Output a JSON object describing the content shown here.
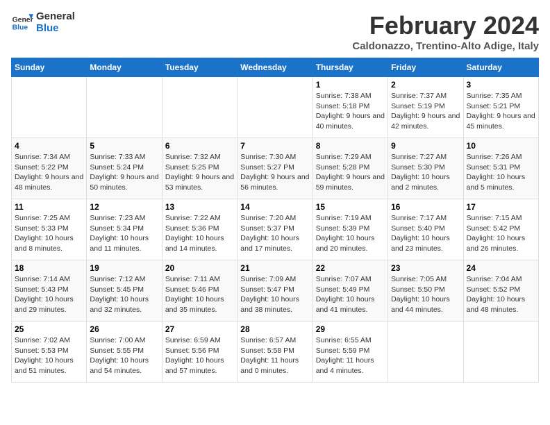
{
  "logo": {
    "line1": "General",
    "line2": "Blue"
  },
  "title": "February 2024",
  "subtitle": "Caldonazzo, Trentino-Alto Adige, Italy",
  "weekdays": [
    "Sunday",
    "Monday",
    "Tuesday",
    "Wednesday",
    "Thursday",
    "Friday",
    "Saturday"
  ],
  "weeks": [
    [
      {
        "day": "",
        "info": ""
      },
      {
        "day": "",
        "info": ""
      },
      {
        "day": "",
        "info": ""
      },
      {
        "day": "",
        "info": ""
      },
      {
        "day": "1",
        "info": "Sunrise: 7:38 AM\nSunset: 5:18 PM\nDaylight: 9 hours and 40 minutes."
      },
      {
        "day": "2",
        "info": "Sunrise: 7:37 AM\nSunset: 5:19 PM\nDaylight: 9 hours and 42 minutes."
      },
      {
        "day": "3",
        "info": "Sunrise: 7:35 AM\nSunset: 5:21 PM\nDaylight: 9 hours and 45 minutes."
      }
    ],
    [
      {
        "day": "4",
        "info": "Sunrise: 7:34 AM\nSunset: 5:22 PM\nDaylight: 9 hours and 48 minutes."
      },
      {
        "day": "5",
        "info": "Sunrise: 7:33 AM\nSunset: 5:24 PM\nDaylight: 9 hours and 50 minutes."
      },
      {
        "day": "6",
        "info": "Sunrise: 7:32 AM\nSunset: 5:25 PM\nDaylight: 9 hours and 53 minutes."
      },
      {
        "day": "7",
        "info": "Sunrise: 7:30 AM\nSunset: 5:27 PM\nDaylight: 9 hours and 56 minutes."
      },
      {
        "day": "8",
        "info": "Sunrise: 7:29 AM\nSunset: 5:28 PM\nDaylight: 9 hours and 59 minutes."
      },
      {
        "day": "9",
        "info": "Sunrise: 7:27 AM\nSunset: 5:30 PM\nDaylight: 10 hours and 2 minutes."
      },
      {
        "day": "10",
        "info": "Sunrise: 7:26 AM\nSunset: 5:31 PM\nDaylight: 10 hours and 5 minutes."
      }
    ],
    [
      {
        "day": "11",
        "info": "Sunrise: 7:25 AM\nSunset: 5:33 PM\nDaylight: 10 hours and 8 minutes."
      },
      {
        "day": "12",
        "info": "Sunrise: 7:23 AM\nSunset: 5:34 PM\nDaylight: 10 hours and 11 minutes."
      },
      {
        "day": "13",
        "info": "Sunrise: 7:22 AM\nSunset: 5:36 PM\nDaylight: 10 hours and 14 minutes."
      },
      {
        "day": "14",
        "info": "Sunrise: 7:20 AM\nSunset: 5:37 PM\nDaylight: 10 hours and 17 minutes."
      },
      {
        "day": "15",
        "info": "Sunrise: 7:19 AM\nSunset: 5:39 PM\nDaylight: 10 hours and 20 minutes."
      },
      {
        "day": "16",
        "info": "Sunrise: 7:17 AM\nSunset: 5:40 PM\nDaylight: 10 hours and 23 minutes."
      },
      {
        "day": "17",
        "info": "Sunrise: 7:15 AM\nSunset: 5:42 PM\nDaylight: 10 hours and 26 minutes."
      }
    ],
    [
      {
        "day": "18",
        "info": "Sunrise: 7:14 AM\nSunset: 5:43 PM\nDaylight: 10 hours and 29 minutes."
      },
      {
        "day": "19",
        "info": "Sunrise: 7:12 AM\nSunset: 5:45 PM\nDaylight: 10 hours and 32 minutes."
      },
      {
        "day": "20",
        "info": "Sunrise: 7:11 AM\nSunset: 5:46 PM\nDaylight: 10 hours and 35 minutes."
      },
      {
        "day": "21",
        "info": "Sunrise: 7:09 AM\nSunset: 5:47 PM\nDaylight: 10 hours and 38 minutes."
      },
      {
        "day": "22",
        "info": "Sunrise: 7:07 AM\nSunset: 5:49 PM\nDaylight: 10 hours and 41 minutes."
      },
      {
        "day": "23",
        "info": "Sunrise: 7:05 AM\nSunset: 5:50 PM\nDaylight: 10 hours and 44 minutes."
      },
      {
        "day": "24",
        "info": "Sunrise: 7:04 AM\nSunset: 5:52 PM\nDaylight: 10 hours and 48 minutes."
      }
    ],
    [
      {
        "day": "25",
        "info": "Sunrise: 7:02 AM\nSunset: 5:53 PM\nDaylight: 10 hours and 51 minutes."
      },
      {
        "day": "26",
        "info": "Sunrise: 7:00 AM\nSunset: 5:55 PM\nDaylight: 10 hours and 54 minutes."
      },
      {
        "day": "27",
        "info": "Sunrise: 6:59 AM\nSunset: 5:56 PM\nDaylight: 10 hours and 57 minutes."
      },
      {
        "day": "28",
        "info": "Sunrise: 6:57 AM\nSunset: 5:58 PM\nDaylight: 11 hours and 0 minutes."
      },
      {
        "day": "29",
        "info": "Sunrise: 6:55 AM\nSunset: 5:59 PM\nDaylight: 11 hours and 4 minutes."
      },
      {
        "day": "",
        "info": ""
      },
      {
        "day": "",
        "info": ""
      }
    ]
  ]
}
